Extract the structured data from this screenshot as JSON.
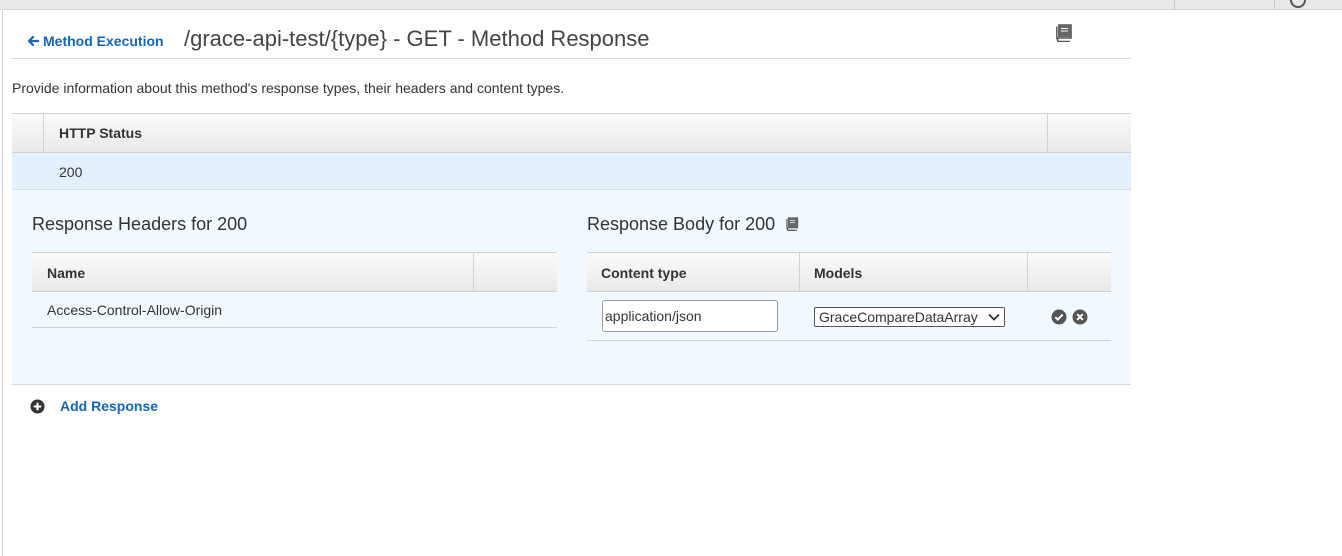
{
  "header": {
    "back_label": "Method Execution",
    "title": "/grace-api-test/{type} - GET - Method Response",
    "doc_icon": "book-icon"
  },
  "description": "Provide information about this method's response types, their headers and content types.",
  "responses_table": {
    "column_header": "HTTP Status",
    "rows": [
      {
        "status": "200"
      }
    ]
  },
  "response_headers": {
    "title": "Response Headers for 200",
    "column_header": "Name",
    "rows": [
      {
        "name": "Access-Control-Allow-Origin"
      }
    ]
  },
  "response_body": {
    "title": "Response Body for 200",
    "title_icon": "book-icon",
    "columns": {
      "content_type": "Content type",
      "models": "Models"
    },
    "rows": [
      {
        "content_type": "application/json",
        "model": "GraceCompareDataArray",
        "confirm_icon": "check-circle-icon",
        "cancel_icon": "x-circle-icon"
      }
    ]
  },
  "add_response": {
    "label": "Add Response",
    "icon": "plus-circle-icon"
  },
  "colors": {
    "link": "#1166bb",
    "selected_row": "#e3f0fb",
    "detail_bg": "#f1f8fe"
  }
}
